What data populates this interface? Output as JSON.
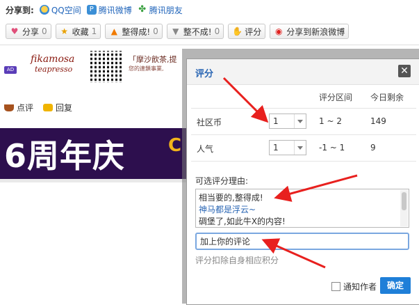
{
  "share": {
    "label": "分享到:",
    "targets": [
      {
        "name": "QQ空间",
        "icon": "qzone-icon"
      },
      {
        "name": "腾讯微博",
        "icon": "tencent-weibo-icon"
      },
      {
        "name": "腾讯朋友",
        "icon": "tencent-friends-icon"
      }
    ]
  },
  "actions": [
    {
      "label": "分享",
      "count": "0",
      "icon": "heart-icon"
    },
    {
      "label": "收藏",
      "count": "1",
      "icon": "star-icon"
    },
    {
      "label": "整得成!",
      "count": "0",
      "icon": "up-arrow-icon"
    },
    {
      "label": "整不成!",
      "count": "0",
      "icon": "down-arrow-icon"
    },
    {
      "label": "评分",
      "count": "",
      "icon": "thumbs-up-icon"
    },
    {
      "label": "分享到新浪微博",
      "count": "",
      "icon": "sina-weibo-icon"
    }
  ],
  "ad": {
    "badge": "AD",
    "brand_line1": "fikamosa",
    "brand_line2": "teapresso",
    "headline": "「摩沙飲茶,提",
    "subline": "您的連鎖事業,"
  },
  "comment_links": [
    {
      "label": "点评",
      "icon": "coffee-cup-icon"
    },
    {
      "label": "回复",
      "icon": "speech-bubble-icon"
    }
  ],
  "banner": {
    "title": "6周年庆"
  },
  "modal": {
    "title": "评分",
    "headers": {
      "range": "评分区间",
      "remaining": "今日剩余"
    },
    "rows": [
      {
        "label": "社区币",
        "value": "1",
        "range": "1 ~ 2",
        "remaining": "149"
      },
      {
        "label": "人气",
        "value": "1",
        "range": "-1 ~ 1",
        "remaining": "9"
      }
    ],
    "reasons_label": "可选评分理由:",
    "reasons": [
      {
        "text": "相当要的,整得成!",
        "color": "#333333"
      },
      {
        "text": "神马都是浮云~",
        "color": "#2a66b4"
      },
      {
        "text": "碉堡了,如此牛X的内容!",
        "color": "#333333"
      }
    ],
    "comment_placeholder": "加上你的评论",
    "hint": "评分扣除自身相应积分",
    "notify_label": "通知作者",
    "submit_label": "确定"
  },
  "colors": {
    "accent": "#2a66b4",
    "submit": "#1f7fd8",
    "annotation": "#e8201e",
    "banner_bg": "#2d0f4e"
  }
}
